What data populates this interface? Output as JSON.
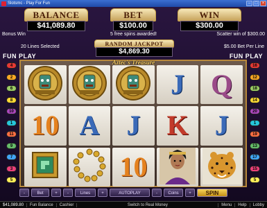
{
  "window": {
    "title": "Slotsmc - Play For Fun"
  },
  "meters": {
    "balance": {
      "label": "BALANCE",
      "value": "$41,089.80"
    },
    "bet": {
      "label": "BET",
      "value": "$100.00"
    },
    "win": {
      "label": "WIN",
      "value": "$300.00"
    }
  },
  "info": {
    "bonus_win": "Bonus Win",
    "free_spins": "5 free spins awarded!",
    "scatter_win": "Scatter win of $300.00",
    "lines_selected": "20 Lines Selected",
    "bet_per_line": "$5.00 Bet Per Line"
  },
  "jackpot": {
    "label": "RANDOM JACKPOT",
    "value": "$4,869.30"
  },
  "fun_play": {
    "left": "FUN PLAY",
    "right": "FUN PLAY"
  },
  "game_logo": "Aztec's Treasure",
  "reels": [
    [
      "gold-idol",
      "gold-idol",
      "gold-idol",
      "J",
      "Q"
    ],
    [
      "10",
      "A",
      "J",
      "K",
      "J"
    ],
    [
      "jade-emblem",
      "gold-necklace",
      "10",
      "aztec-princess",
      "jaguar"
    ]
  ],
  "paylines_left": [
    "4",
    "2",
    "6",
    "8",
    "10",
    "1",
    "11",
    "9",
    "7",
    "3",
    "5"
  ],
  "paylines_right": [
    "16",
    "12",
    "18",
    "14",
    "20",
    "1",
    "19",
    "13",
    "17",
    "15",
    "5"
  ],
  "controls": [
    "-",
    "Bet",
    "+",
    "-",
    "Lines",
    "+",
    "AUTOPLAY",
    "-",
    "Coins",
    "+",
    "SPIN"
  ],
  "status": {
    "balance": "$41,089.80",
    "balance_label": "Fun Balance",
    "cashier": "Cashier",
    "switch": "Switch to Real Money",
    "menu": "Menu",
    "help": "Help",
    "lobby": "Lobby"
  },
  "colors": {
    "accent_gold": "#c9a44a",
    "bg": "#1a0d2e"
  }
}
